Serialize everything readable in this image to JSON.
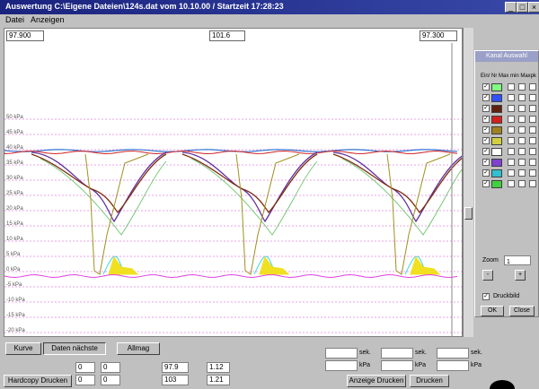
{
  "window": {
    "title": "Auswertung C:\\Eigene Dateien\\124s.dat vom 10.10.00 / Startzeit 17:28:23",
    "buttons": [
      "_",
      "□",
      "×"
    ]
  },
  "menu": [
    "Datei",
    "Anzeigen"
  ],
  "plot": {
    "cursor_left": "97.900",
    "cursor_mid": "101.6",
    "cursor_right": "97.300",
    "y_labels": [
      "50 kPa",
      "45 kPa",
      "40 kPa",
      "35 kPa",
      "30 kPa",
      "25 kPa",
      "20 kPa",
      "15 kPa",
      "10 kPa",
      "5 kPa",
      "0 kPa",
      "-5 kPa",
      "-10 kPa",
      "-15 kPa",
      "-20 kPa"
    ],
    "colors": {
      "grid": "#e8a0e8",
      "blue": "#3070d0",
      "red": "#d02020",
      "darkred": "#803010",
      "olive": "#a09020",
      "purple": "#6030a0",
      "green": "#60c060",
      "cyan": "#40d8e0",
      "yellow": "#f0e020",
      "magenta": "#e040e0"
    }
  },
  "channels": {
    "title": "Kanal Auswahl",
    "header": "Ein/ Nr Max min Maxpk",
    "rows": [
      {
        "color": "#80ff80",
        "checked": true
      },
      {
        "color": "#3050ff",
        "checked": true
      },
      {
        "color": "#602010",
        "checked": true
      },
      {
        "color": "#d02020",
        "checked": true
      },
      {
        "color": "#a08020",
        "checked": true
      },
      {
        "color": "#d0d040",
        "checked": true
      },
      {
        "color": "#ffffff",
        "checked": true
      },
      {
        "color": "#8040d0",
        "checked": true
      },
      {
        "color": "#30c0d0",
        "checked": true
      },
      {
        "color": "#40d040",
        "checked": true
      }
    ],
    "zoom_label": "Zoom",
    "zoom_value": "1",
    "btn_minus": "-",
    "btn_plus": "+",
    "check_label": "Druckbild",
    "btn_ok": "OK",
    "btn_close": "Close"
  },
  "bottom": {
    "tabs": [
      "Kurve",
      "Daten nächste",
      "Allmag"
    ],
    "hardcopy_label": "Hardcopy Drucken",
    "fields_left": [
      "0",
      "0",
      "0",
      "0"
    ],
    "fields_mid": [
      "97.9",
      "1.12",
      "103",
      "1.21"
    ],
    "fields_right": [
      "",
      "",
      "",
      "",
      "",
      ""
    ],
    "units": [
      "sek.",
      "sek.",
      "sek.",
      "kPa",
      "kPa",
      "kPa"
    ],
    "btn_anzeigen": "Anzeige Drucken",
    "btn_drucken": "Drucken"
  }
}
